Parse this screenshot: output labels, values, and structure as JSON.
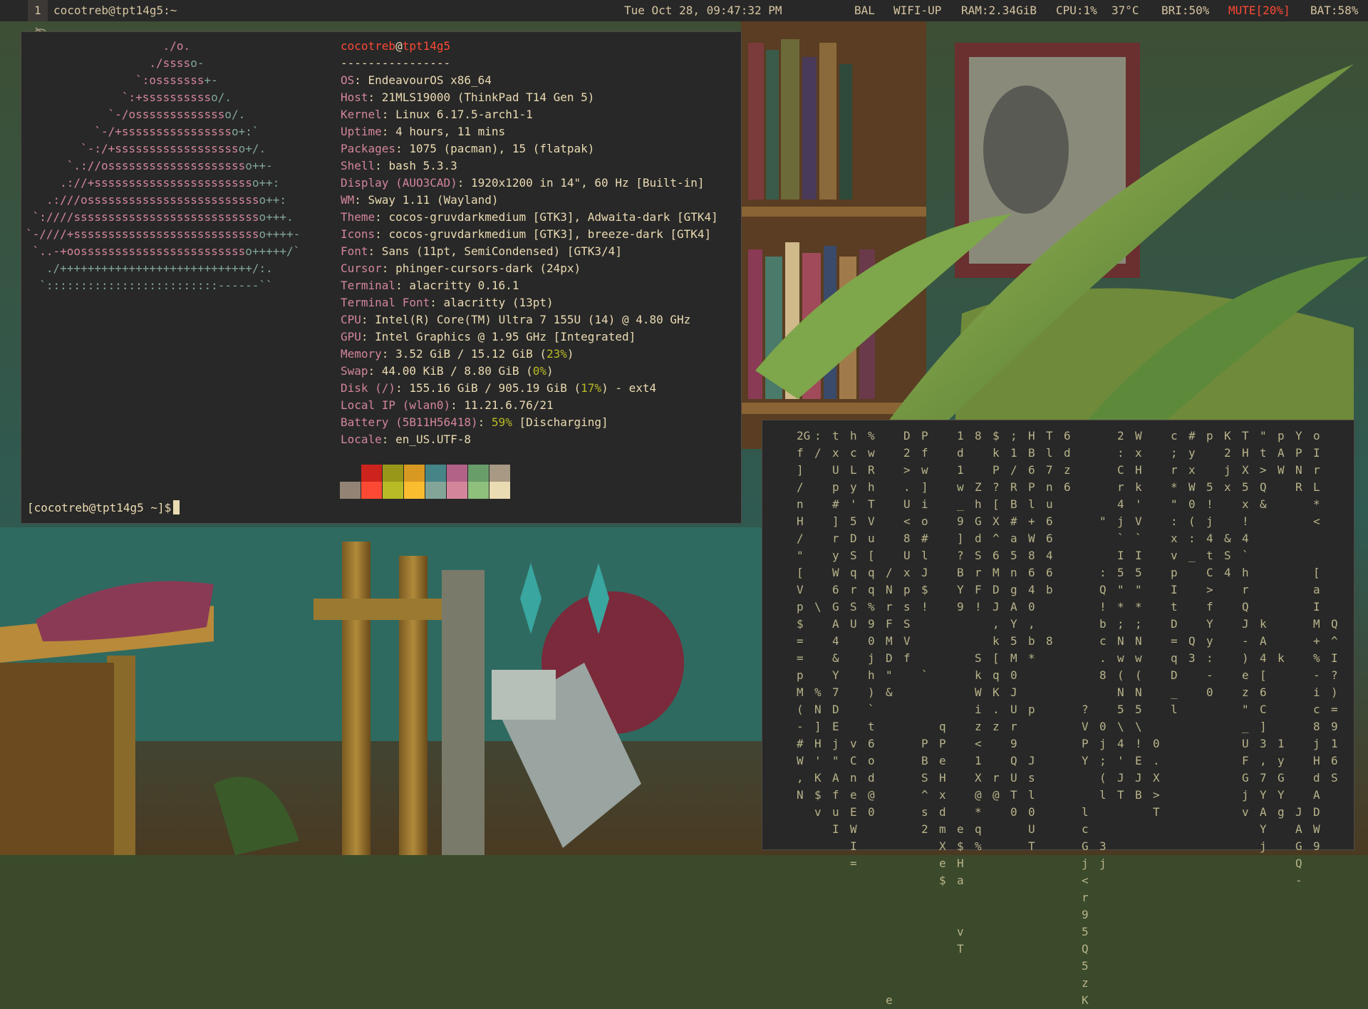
{
  "topbar": {
    "workspace": "1",
    "window_title": "cocotreb@tpt14g5:~",
    "datetime": "Tue Oct 28, 09:47:32 PM",
    "status": {
      "bal": "BAL",
      "wifi": "WIFI-UP",
      "ram": "RAM:2.34GiB",
      "cpu": "CPU:1%",
      "temp": "37°C",
      "bri": "BRI:50%",
      "mute": "MUTE[20%]",
      "bat": "BAT:58%"
    }
  },
  "fetch": {
    "user": "cocotreb",
    "at": "@",
    "host": "tpt14g5",
    "separator": "----------------",
    "rows": [
      {
        "label": "OS",
        "value": "EndeavourOS x86_64"
      },
      {
        "label": "Host",
        "value": "21MLS19000 (ThinkPad T14 Gen 5)"
      },
      {
        "label": "Kernel",
        "value": "Linux 6.17.5-arch1-1"
      },
      {
        "label": "Uptime",
        "value": "4 hours, 11 mins"
      },
      {
        "label": "Packages",
        "value": "1075 (pacman), 15 (flatpak)"
      },
      {
        "label": "Shell",
        "value": "bash 5.3.3"
      },
      {
        "label": "Display (AUO3CAD)",
        "value": "1920x1200 in 14\", 60 Hz [Built-in]"
      },
      {
        "label": "WM",
        "value": "Sway 1.11 (Wayland)"
      },
      {
        "label": "Theme",
        "value": "cocos-gruvdarkmedium [GTK3], Adwaita-dark [GTK4]"
      },
      {
        "label": "Icons",
        "value": "cocos-gruvdarkmedium [GTK3], breeze-dark [GTK4]"
      },
      {
        "label": "Font",
        "value": "Sans (11pt, SemiCondensed) [GTK3/4]"
      },
      {
        "label": "Cursor",
        "value": "phinger-cursors-dark (24px)"
      },
      {
        "label": "Terminal",
        "value": "alacritty 0.16.1"
      },
      {
        "label": "Terminal Font",
        "value": "alacritty (13pt)"
      },
      {
        "label": "CPU",
        "value": "Intel(R) Core(TM) Ultra 7 155U (14) @ 4.80 GHz"
      },
      {
        "label": "GPU",
        "value": "Intel Graphics @ 1.95 GHz [Integrated]"
      },
      {
        "label": "Memory",
        "value_pre": "3.52 GiB / 15.12 GiB (",
        "pct": "23%",
        "value_post": ")"
      },
      {
        "label": "Swap",
        "value_pre": "44.00 KiB / 8.80 GiB (",
        "pct": "0%",
        "value_post": ")"
      },
      {
        "label": "Disk (/)",
        "value_pre": "155.16 GiB / 905.19 GiB (",
        "pct": "17%",
        "value_post": ") - ext4"
      },
      {
        "label": "Local IP (wlan0)",
        "value": "11.21.6.76/21"
      },
      {
        "label": "Battery (5B11H56418)",
        "value_pre": "",
        "pct": "59%",
        "value_post": " [Discharging]"
      },
      {
        "label": "Locale",
        "value": "en_US.UTF-8"
      }
    ],
    "logo": [
      "                    ./o.",
      "                  ./sssso-",
      "                `:osssssss+-",
      "              `:+sssssssssso/.",
      "            `-/ossssssssssssso/.",
      "          `-/+sssssssssssssssso+:`",
      "        `-:/+sssssssssssssssssso+/.",
      "      `.://osssssssssssssssssssso++-",
      "     .://+ssssssssssssssssssssssso++:",
      "   .:///ossssssssssssssssssssssssso++:",
      " `:////ssssssssssssssssssssssssssso+++.",
      "`-////+ssssssssssssssssssssssssssso++++-",
      " `..-+oosssssssssssssssssssssssso+++++/`",
      "   ./++++++++++++++++++++++++++++/:.",
      "  `:::::::::::::::::::::::::------``"
    ],
    "palette": [
      "#282828",
      "#cc241d",
      "#98971a",
      "#d79921",
      "#458588",
      "#b16286",
      "#689d6a",
      "#a89984",
      "#928374",
      "#fb4934",
      "#b8bb26",
      "#fabd2f",
      "#83a598",
      "#d3869b",
      "#8ec07c",
      "#ebdbb2"
    ]
  },
  "prompt": "[cocotreb@tpt14g5 ~]$",
  "matrix": {
    "columns": [
      "2G f ] / n H / \" [ V p $ = = p M ( - # W , N",
      ": /         \\     % N ] H ' K $ v",
      "t x U p # ] r y W 6 G A 4 & Y 7 D E j \" A f u I",
      "h c L y ' 5 D S q r S U       v C n e E W I =",
      "% w R h T V u [ q q % 9 0 j h ) ` t 6 o d @ 0",
      "        / N r F M D \" &                  e",
      "D 2 > . U < 8 U x p s S V f",
      "P f w ] i o # l J $ !    `    P B S ^ s 2",
      "                 q P e H x d m X e $",
      "1 d 1 w _ 9 ] ? B Y 9             e $ H a   v T",
      "8   Z h G d S r F !   S k W i z < 1 X @ * q %",
      "$ k P ? [ X ^ 6 M D J , k [ q K . z   r @",
      "; 1 / R B # a 5 n g A Y 5 M 0 J U r 9 Q U T 0",
      "H B 6 P l + W 8 6 4 0 , b *   p   J s l 0 U T",
      "T l 7 n u 6 6 4 6 b   8",
      "6 d z 6",
      "                ? V P Y   l c G j < r 9 5 Q 5 z K",
      "     \"   : Q ! b c . 8   0 j ; ( l   3 j",
      "2 : C r 4 j ` I 5 \" * ; N w ( N 5 \\ 4 ' J T",
      "W x H k ' V ` I 5 \" * ; N w ( N 5 \\ ! E J B",
      "                  0 . X > T",
      "c ; r * \" : x v p I t D = q D _ l",
      "# y x W 0 ( : _     Q 3",
      "p   5 ! j 4 t C > f Y y : - 0",
      "K 2 j x   & S 4",
      "T H X 5 x ! 4 ` h r Q J - ) e z \" _ U F G j v",
      "\" t > Q &       k A 4 [ 6 C ] 3 , 7 Y A Y j",
      "p A W           k     1 y G Y g",
      "Y P N R                   J A G Q -",
      "o I r L * <   [ a I M + % - i c 8 j H d A D W 9",
      "           Q ^ I ? ) = 9 1 6 S"
    ]
  }
}
